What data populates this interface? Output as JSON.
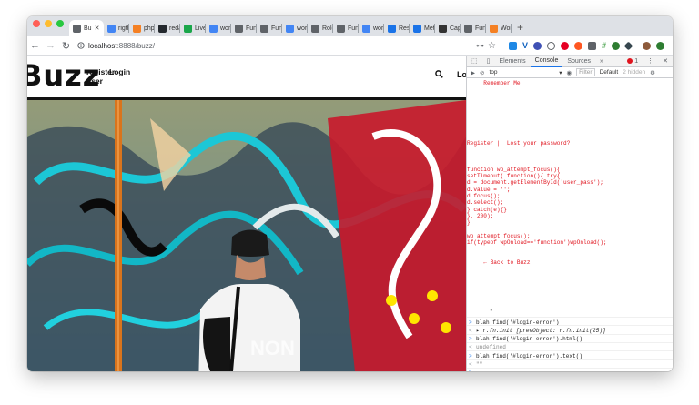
{
  "browser": {
    "tabs": [
      {
        "label": "Bu",
        "icon": "site-icon",
        "color": "#5f6368",
        "active": true
      },
      {
        "label": "rigth",
        "icon": "google-icon",
        "color": "#4285f4"
      },
      {
        "label": "php",
        "icon": "stackoverflow-icon",
        "color": "#f48024"
      },
      {
        "label": "reda",
        "icon": "github-icon",
        "color": "#24292e"
      },
      {
        "label": "Live",
        "icon": "live-icon",
        "color": "#1aa64a"
      },
      {
        "label": "word",
        "icon": "google-icon",
        "color": "#4285f4"
      },
      {
        "label": "Func",
        "icon": "wordpress-icon",
        "color": "#5f6368"
      },
      {
        "label": "Func",
        "icon": "wordpress-icon",
        "color": "#5f6368"
      },
      {
        "label": "word",
        "icon": "google-icon",
        "color": "#4285f4"
      },
      {
        "label": "Role",
        "icon": "wordpress-icon",
        "color": "#5f6368"
      },
      {
        "label": "Func",
        "icon": "wordpress-icon",
        "color": "#5f6368"
      },
      {
        "label": "word",
        "icon": "google-icon",
        "color": "#4285f4"
      },
      {
        "label": "Restr",
        "icon": "cursor-icon",
        "color": "#1a73e8"
      },
      {
        "label": "Meta",
        "icon": "j-icon",
        "color": "#1a73e8"
      },
      {
        "label": "Capa",
        "icon": "w-icon",
        "color": "#333"
      },
      {
        "label": "Func",
        "icon": "wordpress-icon",
        "color": "#5f6368"
      },
      {
        "label": "Word",
        "icon": "stackoverflow-icon",
        "color": "#f48024"
      }
    ],
    "close_glyph": "✕",
    "new_tab_glyph": "+",
    "url_host": "localhost",
    "url_path": ":8888/buzz/",
    "key_glyph": "⊶",
    "star_glyph": "☆"
  },
  "site": {
    "logo": "Buzz",
    "nav_register": "register\nuser",
    "nav_login": "Login",
    "nav_log_partial": "Lo"
  },
  "devtools": {
    "tabs": [
      "Elements",
      "Console",
      "Sources",
      "»"
    ],
    "active_tab": "Console",
    "error_count": "1",
    "context": "top",
    "filter_placeholder": "Filter",
    "level": "Default",
    "hidden": "2 hidden",
    "output_lines": [
      "     Remember Me",
      "",
      "",
      "",
      "",
      "",
      "",
      "",
      "",
      "Register |  Lost your password?",
      "",
      "",
      "",
      "function wp_attempt_focus(){",
      "setTimeout( function(){ try{",
      "d = document.getElementById('user_pass');",
      "d.value = '';",
      "d.focus();",
      "d.select();",
      "} catch(e){}",
      "}, 200);",
      "}",
      "",
      "wp_attempt_focus();",
      "if(typeof wpOnload=='function')wpOnload();",
      "",
      "",
      "     ← Back to Buzz",
      "",
      "",
      "",
      "",
      "",
      "",
      ""
    ],
    "quote_mark": "\"",
    "console": [
      {
        "prompt": ">",
        "text": "blah.find('#login-error')",
        "style": "input"
      },
      {
        "prompt": "<",
        "text": "▸ r.fn.init [prevObject: r.fn.init(25)]",
        "style": "result"
      },
      {
        "prompt": ">",
        "text": "blah.find('#login-error').html()",
        "style": "input"
      },
      {
        "prompt": "<",
        "text": "undefined",
        "style": "muted"
      },
      {
        "prompt": ">",
        "text": "blah.find('#login-error').text()",
        "style": "input"
      },
      {
        "prompt": "<",
        "text": "\"\"",
        "style": "muted"
      },
      {
        "prompt": ">",
        "text": "",
        "style": "cursor"
      }
    ]
  }
}
